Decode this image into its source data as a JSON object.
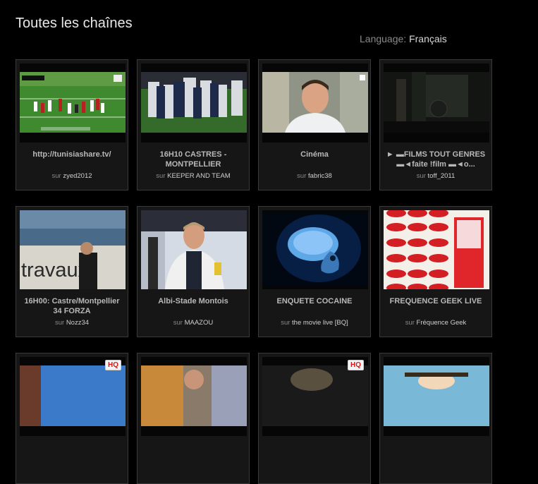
{
  "page": {
    "title": "Toutes les chaînes",
    "language_label": "Language:",
    "language_value": "Français",
    "source_prefix": "sur"
  },
  "channels": [
    {
      "title": "http://tunisiashare.tv/",
      "source": "zyed2012",
      "thumb": "rugby-field-green"
    },
    {
      "title": "16H10 CASTRES - MONTPELLIER",
      "source": "KEEPER AND TEAM",
      "thumb": "rugby-scrum"
    },
    {
      "title": "Cinéma",
      "source": "fabric38",
      "thumb": "man-talking"
    },
    {
      "title": "► ▬FILMS TOUT GENRES ▬◄faite !film ▬◄o...",
      "source": "toff_2011",
      "thumb": "dark-room"
    },
    {
      "title": "16H00: Castre/Montpellier 34 FORZA",
      "source": "Nozz34",
      "thumb": "travaux-sign",
      "thumb_text": "travaux"
    },
    {
      "title": "Albi-Stade Montois",
      "source": "MAAZOU",
      "thumb": "rugby-player"
    },
    {
      "title": "ENQUETE COCAINE",
      "source": "the movie live [BQ]",
      "thumb": "blue-brain"
    },
    {
      "title": "FREQUENCE GEEK LIVE",
      "source": "Fréquence Geek",
      "thumb": "red-logos"
    },
    {
      "title": "",
      "source": "",
      "thumb": "partial-blue",
      "hq": "HQ"
    },
    {
      "title": "",
      "source": "",
      "thumb": "partial-person"
    },
    {
      "title": "",
      "source": "",
      "thumb": "partial-dark",
      "hq": "HQ"
    },
    {
      "title": "",
      "source": "",
      "thumb": "partial-cartoon"
    }
  ]
}
